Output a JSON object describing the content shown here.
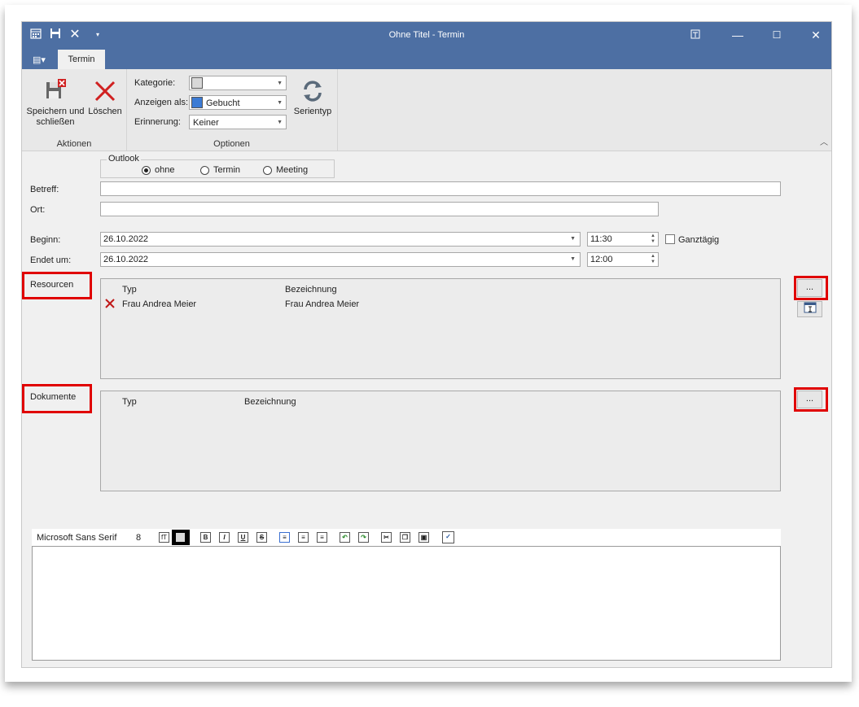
{
  "window": {
    "title": "Ohne Titel - Termin",
    "tab_active": "Termin"
  },
  "ribbon": {
    "save_close_label_1": "Speichern und",
    "save_close_label_2": "schließen",
    "delete_label": "Löschen",
    "group_actions": "Aktionen",
    "group_options": "Optionen",
    "kategorie_label": "Kategorie:",
    "kategorie_value": "",
    "anzeigen_label": "Anzeigen als:",
    "anzeigen_value": "Gebucht",
    "anzeigen_color": "#3c7bd4",
    "erinnerung_label": "Erinnerung:",
    "erinnerung_value": "Keiner",
    "serientyp_label": "Serientyp"
  },
  "form": {
    "outlook_label": "Outlook",
    "radio_options": [
      "ohne",
      "Termin",
      "Meeting"
    ],
    "radio_selected": "ohne",
    "betreff_label": "Betreff:",
    "betreff_value": "",
    "ort_label": "Ort:",
    "ort_value": "",
    "beginn_label": "Beginn:",
    "beginn_date": "26.10.2022",
    "beginn_time": "11:30",
    "ganztaegig_label": "Ganztägig",
    "ganztaegig_checked": false,
    "ende_label": "Endet um:",
    "ende_date": "26.10.2022",
    "ende_time": "12:00"
  },
  "resources": {
    "label": "Resourcen",
    "col_typ": "Typ",
    "col_bezeichnung": "Bezeichnung",
    "rows": [
      {
        "typ": "Frau Andrea Meier",
        "bezeichnung": "Frau Andrea Meier"
      }
    ],
    "more_button": "..."
  },
  "documents": {
    "label": "Dokumente",
    "col_typ": "Typ",
    "col_bezeichnung": "Bezeichnung",
    "rows": [],
    "more_button": "..."
  },
  "editor": {
    "font_name": "Microsoft Sans Serif",
    "font_size": "8",
    "content": ""
  },
  "colors": {
    "titlebar": "#4d6fa3",
    "highlight": "#e00000"
  }
}
